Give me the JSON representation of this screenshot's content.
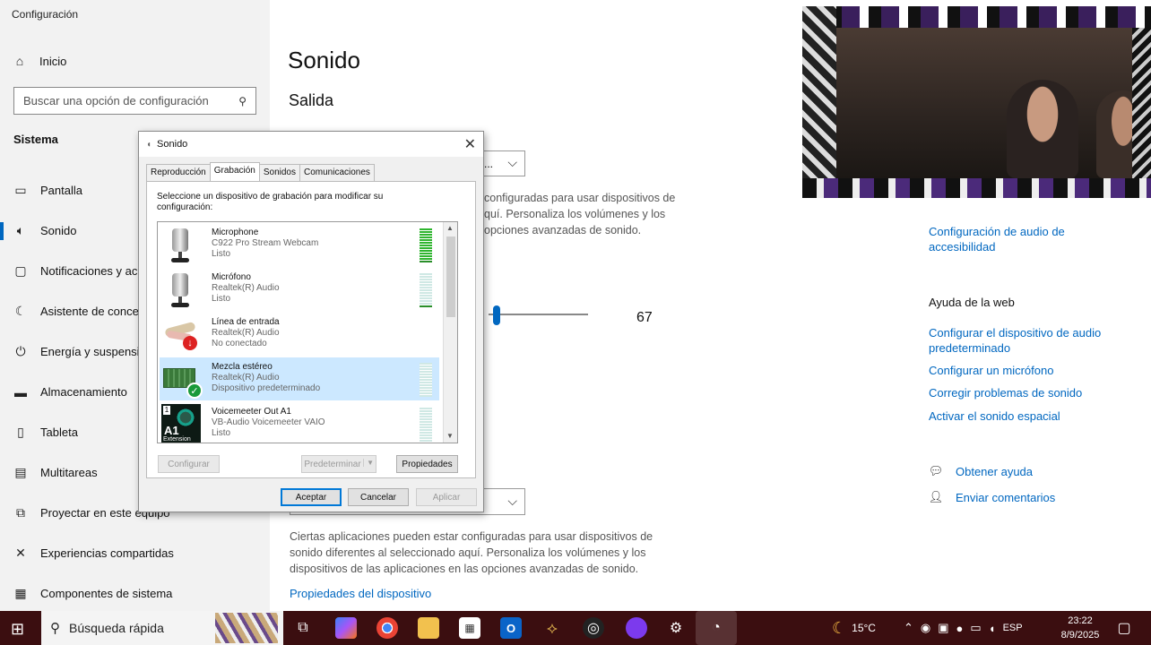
{
  "app_title": "Configuración",
  "sidebar": {
    "home_label": "Inicio",
    "search_placeholder": "Buscar una opción de configuración",
    "section_title": "Sistema",
    "items": [
      {
        "label": "Pantalla",
        "icon": "monitor-icon"
      },
      {
        "label": "Sonido",
        "icon": "speaker-icon",
        "active": true
      },
      {
        "label": "Notificaciones y acciones",
        "icon": "notification-icon"
      },
      {
        "label": "Asistente de concentración",
        "icon": "moon-icon"
      },
      {
        "label": "Energía y suspensión",
        "icon": "power-icon"
      },
      {
        "label": "Almacenamiento",
        "icon": "storage-icon"
      },
      {
        "label": "Tableta",
        "icon": "tablet-icon"
      },
      {
        "label": "Multitareas",
        "icon": "multitask-icon"
      },
      {
        "label": "Proyectar en este equipo",
        "icon": "project-icon"
      },
      {
        "label": "Experiencias compartidas",
        "icon": "shared-icon"
      },
      {
        "label": "Componentes de sistema",
        "icon": "components-icon"
      }
    ]
  },
  "main": {
    "title": "Sonido",
    "subtitle": "Salida",
    "dropdown_stub": "...",
    "para_top": [
      "Ciertas aplicaciones pueden estar configuradas para usar dispositivos de",
      "sonido diferentes al seleccionado aquí. Personaliza los volúmenes y los",
      "dispositivos de las aplicaciones en las opciones avanzadas de sonido."
    ],
    "para_top_visible": [
      "configuradas para usar dispositivos de",
      "quí. Personaliza los volúmenes y los",
      "opciones avanzadas de sonido."
    ],
    "volume": 67,
    "para_bottom": [
      "Ciertas aplicaciones pueden estar configuradas para usar dispositivos de",
      "sonido diferentes al seleccionado aquí. Personaliza los volúmenes y los",
      "dispositivos de las aplicaciones en las opciones avanzadas de sonido."
    ],
    "device_props_link": "Propiedades del dispositivo"
  },
  "right": {
    "accessibility_link": [
      "Configuración de audio de",
      "accesibilidad"
    ],
    "help_heading": "Ayuda de la web",
    "links": [
      [
        "Configurar el dispositivo de audio",
        "predeterminado"
      ],
      [
        "Configurar un micrófono"
      ],
      [
        "Corregir problemas de sonido"
      ],
      [
        "Activar el sonido espacial"
      ]
    ],
    "get_help": "Obtener ayuda",
    "feedback": "Enviar comentarios"
  },
  "dialog": {
    "title": "Sonido",
    "tabs": [
      "Reproducción",
      "Grabación",
      "Sonidos",
      "Comunicaciones"
    ],
    "active_tab": 1,
    "instruction": "Seleccione un dispositivo de grabación para modificar su configuración:",
    "devices": [
      {
        "name": "Microphone",
        "desc": "C922 Pro Stream Webcam",
        "status": "Listo",
        "icon": "microphone-icon",
        "meter": "on"
      },
      {
        "name": "Micrófono",
        "desc": "Realtek(R) Audio",
        "status": "Listo",
        "icon": "microphone-icon",
        "meter": "off"
      },
      {
        "name": "Línea de entrada",
        "desc": "Realtek(R) Audio",
        "status": "No conectado",
        "icon": "line-in-icon",
        "meter": "none"
      },
      {
        "name": "Mezcla estéreo",
        "desc": "Realtek(R) Audio",
        "status": "Dispositivo predeterminado",
        "icon": "sound-card-icon",
        "meter": "off",
        "selected": true
      },
      {
        "name": "Voicemeeter Out A1",
        "desc": "VB-Audio Voicemeeter VAIO",
        "status": "Listo",
        "icon": "voicemeeter-icon",
        "meter": "off",
        "icon_text": "A1",
        "icon_subtext": "Extension"
      }
    ],
    "btn_configure": "Configurar",
    "btn_default": "Predeterminar",
    "btn_properties": "Propiedades",
    "btn_ok": "Aceptar",
    "btn_cancel": "Cancelar",
    "btn_apply": "Aplicar"
  },
  "taskbar": {
    "search_label": "Búsqueda rápida",
    "weather": "15°C",
    "lang": "ESP",
    "time": "23:22",
    "date": "8/9/2025"
  },
  "colors": {
    "accent": "#0067c0",
    "taskbar": "#3b0e10"
  }
}
